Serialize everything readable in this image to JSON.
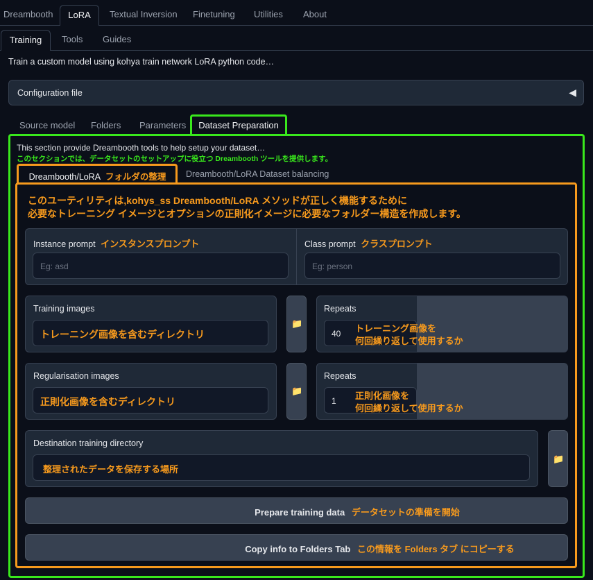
{
  "top_tabs": [
    "Dreambooth",
    "LoRA",
    "Textual Inversion",
    "Finetuning",
    "Utilities",
    "About"
  ],
  "sub_tabs": [
    "Training",
    "Tools",
    "Guides"
  ],
  "description": "Train a custom model using kohya train network LoRA python code…",
  "config": {
    "label": "Configuration file",
    "toggle": "◀"
  },
  "section_tabs": [
    "Source model",
    "Folders",
    "Parameters",
    "Dataset Preparation"
  ],
  "section": {
    "intro": "This section provide Dreambooth tools to help setup your dataset…",
    "intro_jp": "このセクションでは、データセットのセットアップに役立つ Dreambooth ツールを提供します。"
  },
  "inner_tabs": {
    "active": "Dreambooth/LoRA",
    "active_jp": "フォルダの整理",
    "other": "Dreambooth/LoRA Dataset balancing"
  },
  "utility_jp": {
    "line1": "このユーティリティは,kohys_ss Dreambooth/LoRA メソッドが正しく機能するために",
    "line2": "必要なトレーニング イメージとオプションの正則化イメージに必要なフォルダー構造を作成します。"
  },
  "instance_prompt": {
    "label": "Instance prompt",
    "label_jp": "インスタンスプロンプト",
    "placeholder": "Eg: asd"
  },
  "class_prompt": {
    "label": "Class prompt",
    "label_jp": "クラスプロンプト",
    "placeholder": "Eg: person"
  },
  "training_images": {
    "label": "Training images",
    "value_jp": "トレーニング画像を含むディレクトリ"
  },
  "training_repeats": {
    "label": "Repeats",
    "value": "40",
    "note_line1": "トレーニング画像を",
    "note_line2": "何回繰り返して使用するか"
  },
  "reg_images": {
    "label": "Regularisation images",
    "value_jp": "正則化画像を含むディレクトリ"
  },
  "reg_repeats": {
    "label": "Repeats",
    "value": "1",
    "note_line1": "正則化画像を",
    "note_line2": "何回繰り返して使用するか"
  },
  "destination": {
    "label": "Destination training directory",
    "value_jp": "整理されたデータを保存する場所"
  },
  "prepare_button": {
    "label": "Prepare training data",
    "label_jp": "データセットの準備を開始"
  },
  "copy_button": {
    "label": "Copy info to Folders Tab",
    "label_jp": "この情報を Folders タブ にコピーする"
  },
  "icons": {
    "folder": "📁"
  },
  "colors": {
    "highlight_green": "#39e81c",
    "highlight_orange": "#f79a1d",
    "background": "#0b0f19",
    "panel": "#1f2937"
  }
}
